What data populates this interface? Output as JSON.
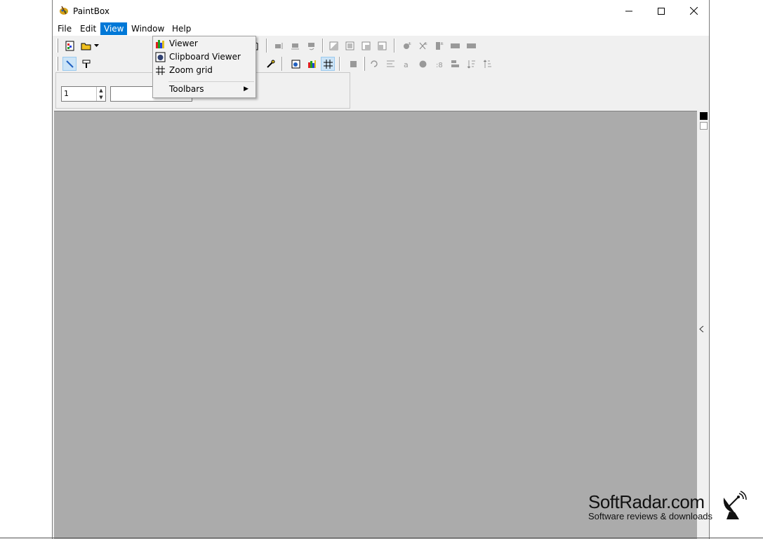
{
  "window": {
    "title": "PaintBox",
    "controls": {
      "minimize": "—",
      "maximize": "☐",
      "close": "✕"
    }
  },
  "menubar": {
    "items": [
      "File",
      "Edit",
      "View",
      "Window",
      "Help"
    ],
    "active": "View"
  },
  "view_menu": {
    "items": [
      {
        "label": "Viewer",
        "icon": "viewer-icon"
      },
      {
        "label": "Clipboard Viewer",
        "icon": "clipboard-viewer-icon"
      },
      {
        "label": "Zoom grid",
        "icon": "grid-icon"
      },
      {
        "label": "Toolbars",
        "icon": "",
        "submenu": true
      }
    ]
  },
  "options_panel": {
    "line_width_value": "1"
  },
  "palette": {
    "foreground": "#000000",
    "background": "#ffffff"
  },
  "canvas": {
    "background": "#ababab"
  },
  "watermark": {
    "title": "SoftRadar.com",
    "subtitle": "Software reviews & downloads"
  }
}
